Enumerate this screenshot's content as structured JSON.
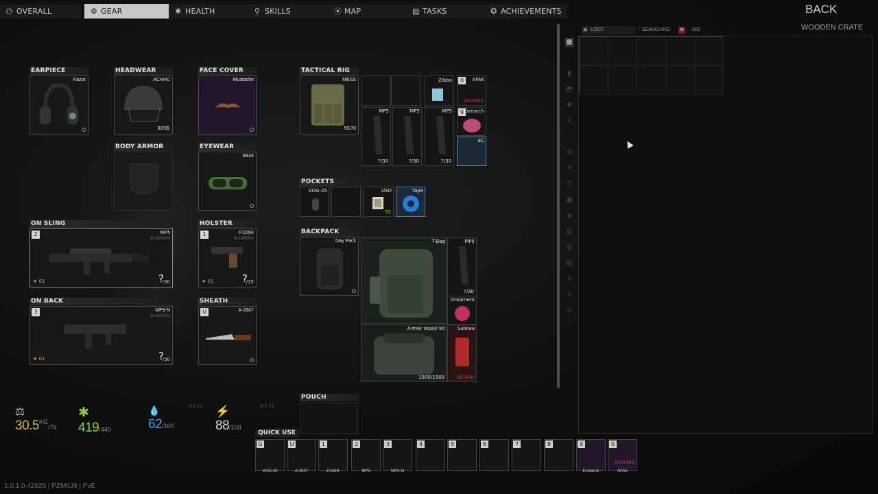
{
  "nav": {
    "tabs": [
      {
        "label": "OVERALL",
        "icon": "person-icon"
      },
      {
        "label": "GEAR",
        "icon": "gear-icon"
      },
      {
        "label": "HEALTH",
        "icon": "health-icon"
      },
      {
        "label": "SKILLS",
        "icon": "skills-icon"
      },
      {
        "label": "MAP",
        "icon": "map-pin-icon"
      },
      {
        "label": "TASKS",
        "icon": "tasks-icon"
      },
      {
        "label": "ACHIEVEMENTS",
        "icon": "achievements-icon"
      }
    ],
    "active_tab": "GEAR",
    "back_label": "BACK",
    "container_name": "WOODEN CRATE"
  },
  "equipment": {
    "earpiece": {
      "title": "EARPIECE",
      "item": "Razor"
    },
    "headwear": {
      "title": "HEADWEAR",
      "item": "ACHHC",
      "durability": "30/36"
    },
    "face_cover": {
      "title": "FACE COVER",
      "item": "Mustache"
    },
    "body_armor": {
      "title": "BODY ARMOR"
    },
    "eyewear": {
      "title": "EYEWEAR",
      "item": "6B34"
    },
    "on_sling": {
      "title": "ON SLING",
      "key": "2",
      "item": "MP5",
      "caliber": "9x19PARA",
      "ammo": "?",
      "mag": "/30",
      "mod": "01"
    },
    "holster": {
      "title": "HOLSTER",
      "key": "1",
      "item": "P226R",
      "caliber": "9x19PARA",
      "ammo": "?",
      "mag": "/15",
      "mod": "01"
    },
    "on_back": {
      "title": "ON BACK",
      "key": "3",
      "item": "MP9-N",
      "caliber": "9x19PARA",
      "ammo": "?",
      "mag": "/30",
      "mod": "01"
    },
    "sheath": {
      "title": "SHEATH",
      "key": "U",
      "item": "A-2607"
    },
    "tactical_rig": {
      "title": "TACTICAL RIG",
      "item": "MBSS",
      "capacity": "55/70",
      "contents": [
        {
          "name": "Zibbo"
        },
        {
          "name": "AFAK",
          "key": "0",
          "count": "240/400"
        },
        {
          "name": "MP5",
          "count": "?/30"
        },
        {
          "name": "MP5",
          "count": "?/30"
        },
        {
          "name": "MP5",
          "count": "?/30"
        },
        {
          "name": "Esmarch",
          "key": "9"
        },
        {
          "name": "EC"
        }
      ]
    },
    "pockets": {
      "title": "POCKETS",
      "contents": [
        {
          "name": "VOG-25"
        },
        {
          "name": ""
        },
        {
          "name": "USD",
          "count": "52"
        },
        {
          "name": "Tape"
        }
      ]
    },
    "backpack": {
      "title": "BACKPACK",
      "item": "Day Pack",
      "contents": [
        {
          "name": "T-Bag"
        },
        {
          "name": "MP5",
          "count": "?/30"
        },
        {
          "name": "Ornament"
        },
        {
          "name": "Armor repair kit",
          "count": "1500/1500"
        },
        {
          "name": "Salewa",
          "count": "82/400"
        }
      ]
    },
    "pouch": {
      "title": "POUCH"
    }
  },
  "stats": {
    "weight": {
      "value": "30.5",
      "unit": "KG",
      "max": "/79"
    },
    "health": {
      "value": "419",
      "max": "/440"
    },
    "hydration": {
      "value": "62",
      "max": "/100",
      "delta": "▾-3.12"
    },
    "energy": {
      "value": "88",
      "max": "/100",
      "delta": "▾-3.71"
    }
  },
  "loot": {
    "tab_label": "LOOT",
    "status": "SEARCHING",
    "timer": "003"
  },
  "quick_use": {
    "title": "QUICK USE",
    "slots": [
      {
        "key": "G",
        "label": "VOG-25"
      },
      {
        "key": "U",
        "label": "A-2607"
      },
      {
        "key": "1",
        "label": "P226R"
      },
      {
        "key": "2",
        "label": "MP5"
      },
      {
        "key": "3",
        "label": "MP9-N"
      },
      {
        "key": "4",
        "label": ""
      },
      {
        "key": "5",
        "label": ""
      },
      {
        "key": "6",
        "label": ""
      },
      {
        "key": "7",
        "label": ""
      },
      {
        "key": "8",
        "label": ""
      },
      {
        "key": "9",
        "label": "Esmarch"
      },
      {
        "key": "0",
        "label": "AFAK",
        "count": "240/400"
      }
    ]
  },
  "version": "1.0.1.0.42625 | PZM4J9 | PvE",
  "colors": {
    "accent_active_tab": "#c7c8c3",
    "weight": "#e0b24a",
    "health": "#8fcf3a",
    "hydration": "#4aa0e0",
    "energy": "#d8d8d0",
    "alert": "#b03030"
  }
}
